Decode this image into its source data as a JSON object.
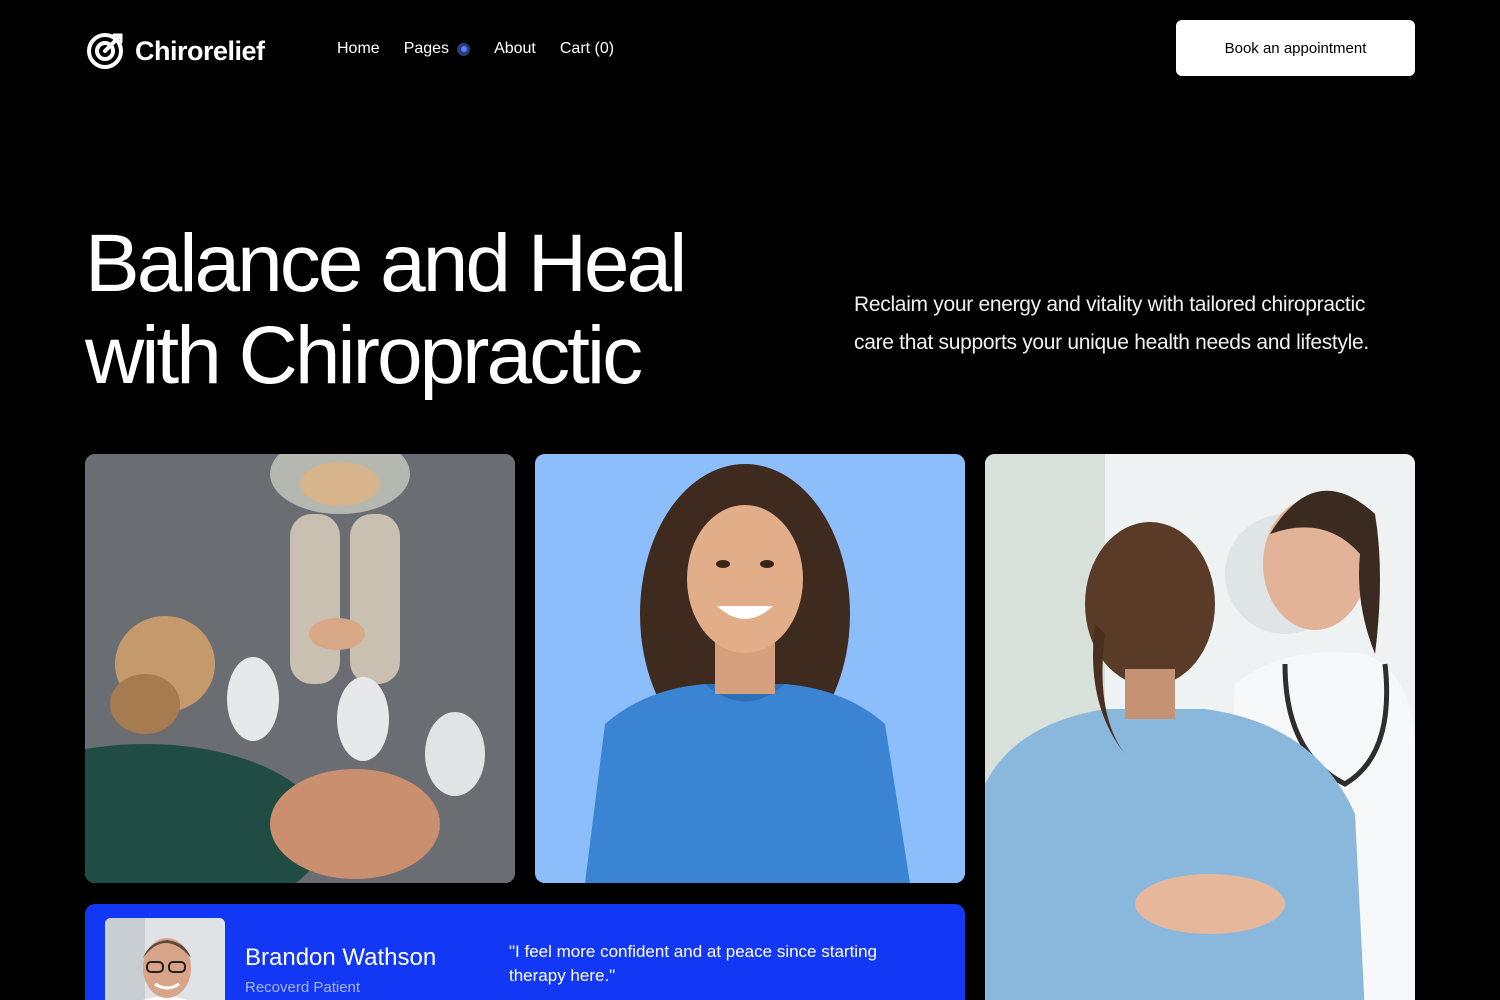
{
  "header": {
    "brand": "Chirorelief",
    "nav": [
      {
        "label": "Home"
      },
      {
        "label": "Pages"
      },
      {
        "label": "About"
      },
      {
        "label": "Cart (0)"
      }
    ],
    "cta_label": "Book an appointment"
  },
  "hero": {
    "title_line1": "Balance and Heal",
    "title_line2": "with Chiropractic",
    "subtitle": "Reclaim your energy and vitality with tailored chiropractic care that supports your unique health needs and lifestyle."
  },
  "testimonial": {
    "name": "Brandon Wathson",
    "role": "Recoverd Patient",
    "quote": "\"I feel more confident and at peace since starting therapy here.\""
  },
  "colors": {
    "background": "#000000",
    "accent_blue": "#1237f5",
    "card_light_blue": "#8dbefc",
    "button_bg": "#ffffff"
  },
  "icons": {
    "logo": "target-check-icon",
    "pages_indicator": "dot-indicator-icon"
  }
}
